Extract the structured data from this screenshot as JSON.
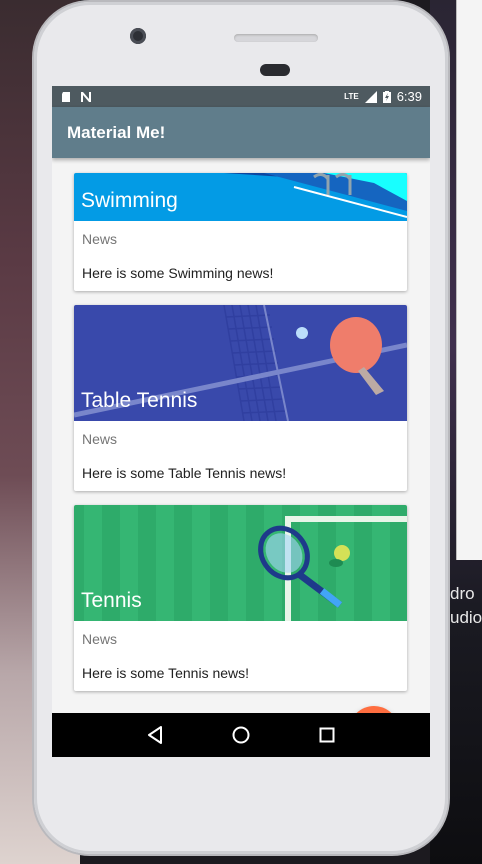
{
  "background": {
    "text_lines": [
      "dro",
      "udio"
    ]
  },
  "statusbar": {
    "time": "6:39",
    "network": "LTE",
    "icons": [
      "sd-card-icon",
      "n-notification-icon",
      "signal-icon",
      "battery-charging-icon"
    ]
  },
  "toolbar": {
    "title": "Material Me!"
  },
  "cards": [
    {
      "title": "Swimming",
      "subtitle": "News",
      "info": "Here is some Swimming news!",
      "image": "swimming-image"
    },
    {
      "title": "Table Tennis",
      "subtitle": "News",
      "info": "Here is some Table Tennis news!",
      "image": "table-tennis-image"
    },
    {
      "title": "Tennis",
      "subtitle": "News",
      "info": "Here is some Tennis news!",
      "image": "tennis-image"
    }
  ],
  "fab": {
    "icon": "refresh-icon"
  },
  "navbar": {
    "buttons": [
      "back-icon",
      "home-icon",
      "recents-icon"
    ]
  },
  "colors": {
    "toolbar": "#607d8b",
    "statusbar": "#4e5a60",
    "fab": "#ff6e40",
    "swimming": "#039be5",
    "table_tennis": "#3949ab",
    "tennis": "#2eab6a"
  }
}
